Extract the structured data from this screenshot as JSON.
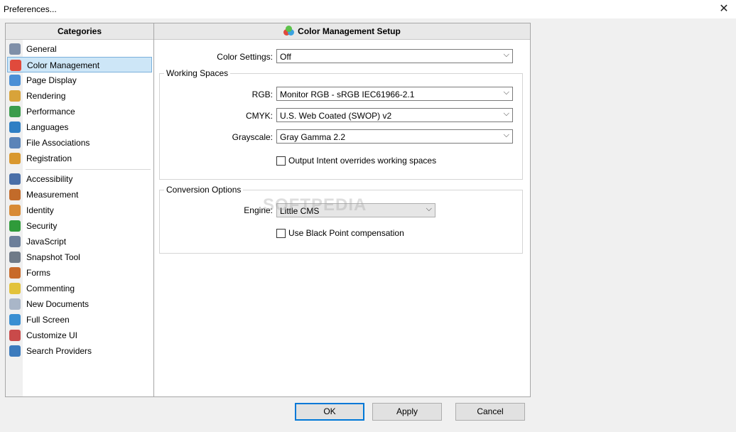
{
  "window": {
    "title": "Preferences...",
    "close_glyph": "✕"
  },
  "categories": {
    "header": "Categories",
    "items": [
      {
        "label": "General",
        "icon": "gear-icon",
        "color": "#7f8fa8"
      },
      {
        "label": "Color Management",
        "icon": "color-circles-icon",
        "color": "#e04a3c",
        "selected": true
      },
      {
        "label": "Page Display",
        "icon": "page-magnifier-icon",
        "color": "#4a8fd6"
      },
      {
        "label": "Rendering",
        "icon": "paint-bucket-icon",
        "color": "#d8a33a"
      },
      {
        "label": "Performance",
        "icon": "chart-icon",
        "color": "#3a9c4c"
      },
      {
        "label": "Languages",
        "icon": "globe-icon",
        "color": "#2f7fc4"
      },
      {
        "label": "File Associations",
        "icon": "file-associations-icon",
        "color": "#5b84b8"
      },
      {
        "label": "Registration",
        "icon": "registration-user-icon",
        "color": "#d9982f"
      },
      {
        "label": "Accessibility",
        "icon": "accessibility-icon",
        "color": "#4a6fa8"
      },
      {
        "label": "Measurement",
        "icon": "ruler-icon",
        "color": "#c26b2a"
      },
      {
        "label": "Identity",
        "icon": "identity-user-icon",
        "color": "#d88a35"
      },
      {
        "label": "Security",
        "icon": "shield-icon",
        "color": "#2f9b3a"
      },
      {
        "label": "JavaScript",
        "icon": "javascript-icon",
        "color": "#6c7f9a"
      },
      {
        "label": "Snapshot Tool",
        "icon": "camera-icon",
        "color": "#6f7a88"
      },
      {
        "label": "Forms",
        "icon": "forms-icon",
        "color": "#c86a2a"
      },
      {
        "label": "Commenting",
        "icon": "comment-icon",
        "color": "#e2c23b"
      },
      {
        "label": "New Documents",
        "icon": "new-document-icon",
        "color": "#a9b6c8"
      },
      {
        "label": "Full Screen",
        "icon": "fullscreen-icon",
        "color": "#3a8fd2"
      },
      {
        "label": "Customize UI",
        "icon": "customize-icon",
        "color": "#c94a4a"
      },
      {
        "label": "Search Providers",
        "icon": "search-globe-icon",
        "color": "#3c7bbd"
      }
    ]
  },
  "main": {
    "header": "Color Management Setup",
    "color_settings": {
      "label": "Color Settings:",
      "value": "Off"
    },
    "working_spaces": {
      "title": "Working Spaces",
      "rgb": {
        "label": "RGB:",
        "value": "Monitor RGB - sRGB IEC61966-2.1"
      },
      "cmyk": {
        "label": "CMYK:",
        "value": "U.S. Web Coated (SWOP) v2"
      },
      "grayscale": {
        "label": "Grayscale:",
        "value": "Gray Gamma 2.2"
      },
      "output_intent": {
        "label": "Output Intent overrides working spaces",
        "checked": false
      }
    },
    "conversion": {
      "title": "Conversion Options",
      "engine": {
        "label": "Engine:",
        "value": "Little CMS"
      },
      "black_point": {
        "label": "Use Black Point compensation",
        "checked": false
      }
    },
    "dropdown_glyph": "⌵",
    "watermark": "SOFTPEDIA"
  },
  "buttons": {
    "ok": "OK",
    "apply": "Apply",
    "cancel": "Cancel"
  },
  "colors": {
    "selection_bg": "#cde6f7",
    "selection_border": "#7ab0dc",
    "default_button_border": "#0078d7"
  }
}
